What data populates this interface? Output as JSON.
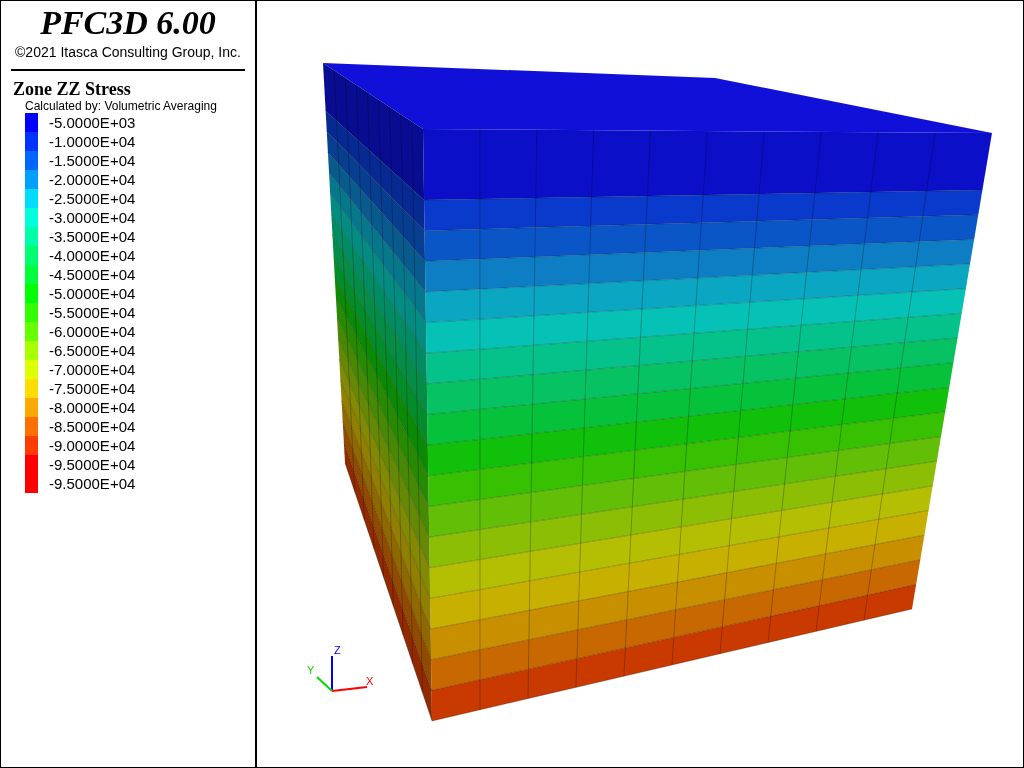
{
  "header": {
    "title": "PFC3D 6.00",
    "copyright": "©2021 Itasca Consulting Group, Inc."
  },
  "legend": {
    "title": "Zone ZZ Stress",
    "subtitle": "Calculated by: Volumetric Averaging",
    "items": [
      {
        "label": "-5.0000E+03",
        "color": "#0000ff"
      },
      {
        "label": "-1.0000E+04",
        "color": "#0033ff"
      },
      {
        "label": "-1.5000E+04",
        "color": "#0066ff"
      },
      {
        "label": "-2.0000E+04",
        "color": "#00a0ff"
      },
      {
        "label": "-2.5000E+04",
        "color": "#00ddff"
      },
      {
        "label": "-3.0000E+04",
        "color": "#00ffdd"
      },
      {
        "label": "-3.5000E+04",
        "color": "#00ffa8"
      },
      {
        "label": "-4.0000E+04",
        "color": "#00ff70"
      },
      {
        "label": "-4.5000E+04",
        "color": "#00ff3c"
      },
      {
        "label": "-5.0000E+04",
        "color": "#00ff00"
      },
      {
        "label": "-5.5000E+04",
        "color": "#33ff00"
      },
      {
        "label": "-6.0000E+04",
        "color": "#66ff00"
      },
      {
        "label": "-6.5000E+04",
        "color": "#a8ff00"
      },
      {
        "label": "-7.0000E+04",
        "color": "#ddff00"
      },
      {
        "label": "-7.5000E+04",
        "color": "#ffdd00"
      },
      {
        "label": "-8.0000E+04",
        "color": "#ffa800"
      },
      {
        "label": "-8.5000E+04",
        "color": "#ff7000"
      },
      {
        "label": "-9.0000E+04",
        "color": "#ff3c00"
      },
      {
        "label": "-9.5000E+04",
        "color": "#ff0000"
      },
      {
        "label": "-9.5000E+04",
        "color": "#ff0000"
      }
    ]
  },
  "axes": {
    "x": "X",
    "y": "Y",
    "z": "Z"
  }
}
